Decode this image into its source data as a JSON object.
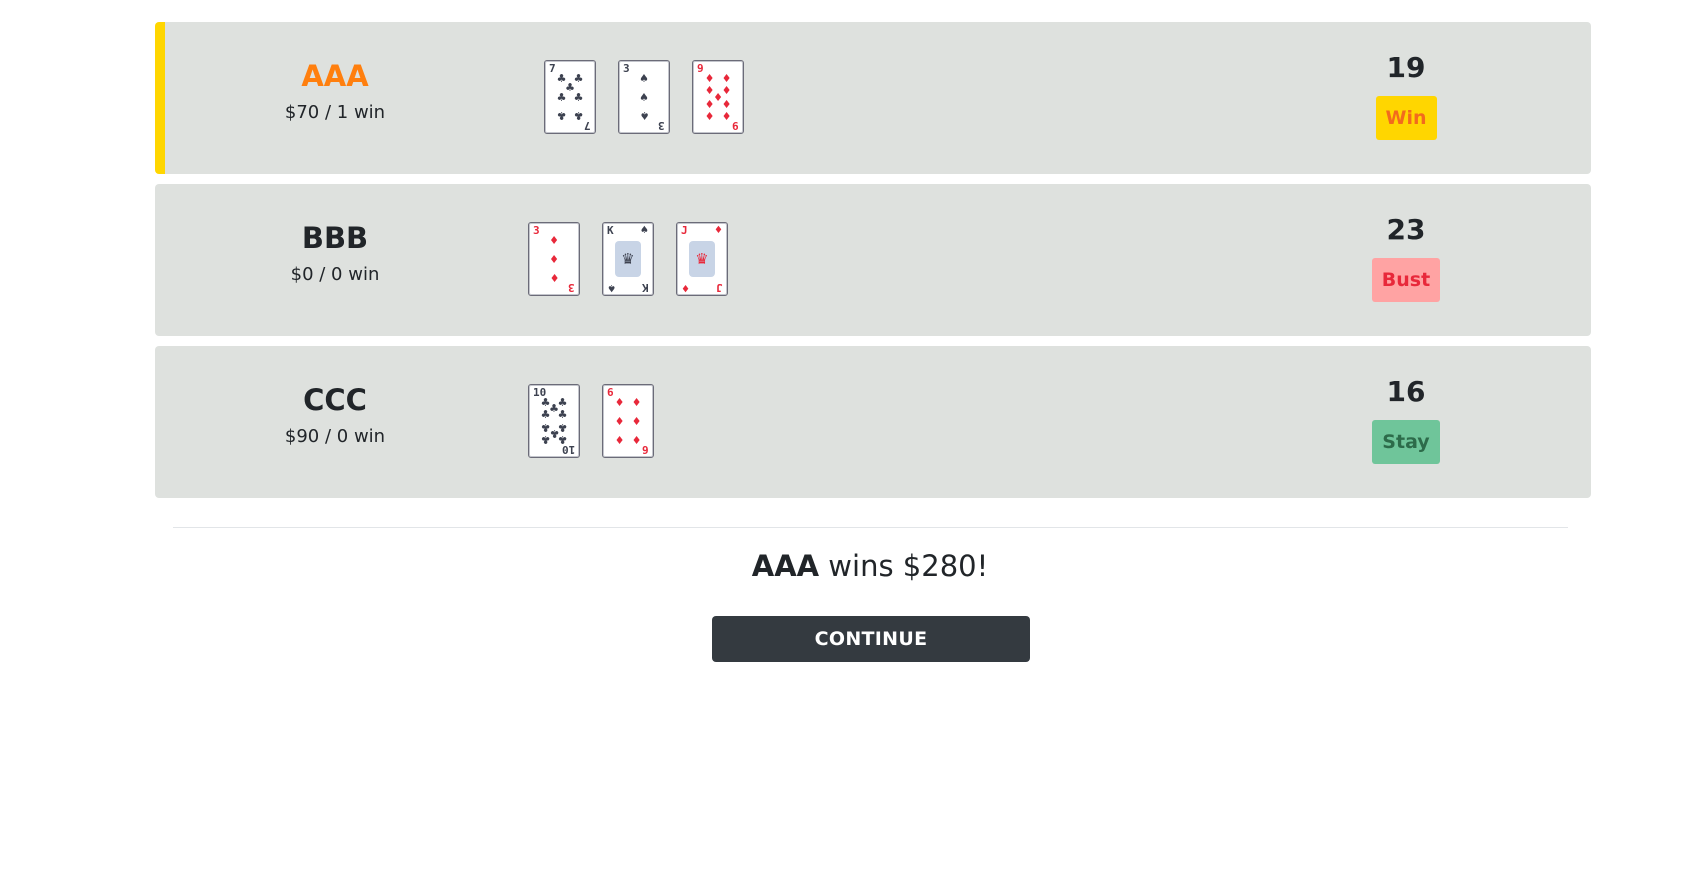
{
  "players": [
    {
      "name": "AAA",
      "stats": "$70 / 1 win",
      "score": "19",
      "status": "Win",
      "winner": true,
      "status_bg": "#ffd600",
      "status_color": "#f26b1d",
      "cards": [
        {
          "rank": "7",
          "suit": "clubs",
          "color": "black",
          "glyph": "♣",
          "type": "pips",
          "pips": 7
        },
        {
          "rank": "3",
          "suit": "spades",
          "color": "black",
          "glyph": "♠",
          "type": "pips",
          "pips": 3
        },
        {
          "rank": "9",
          "suit": "diamonds",
          "color": "red",
          "glyph": "♦",
          "type": "pips",
          "pips": 9
        }
      ]
    },
    {
      "name": "BBB",
      "stats": "$0 / 0 win",
      "score": "23",
      "status": "Bust",
      "winner": false,
      "status_bg": "#ffa3a3",
      "status_color": "#e8283a",
      "cards": [
        {
          "rank": "3",
          "suit": "diamonds",
          "color": "red",
          "glyph": "♦",
          "type": "pips",
          "pips": 3
        },
        {
          "rank": "K",
          "suit": "spades",
          "color": "black",
          "glyph": "♠",
          "type": "face"
        },
        {
          "rank": "J",
          "suit": "diamonds",
          "color": "red",
          "glyph": "♦",
          "type": "face"
        }
      ]
    },
    {
      "name": "CCC",
      "stats": "$90 / 0 win",
      "score": "16",
      "status": "Stay",
      "winner": false,
      "status_bg": "#6fc59a",
      "status_color": "#2d6b4a",
      "cards": [
        {
          "rank": "10",
          "suit": "clubs",
          "color": "black",
          "glyph": "♣",
          "type": "pips",
          "pips": 10
        },
        {
          "rank": "6",
          "suit": "diamonds",
          "color": "red",
          "glyph": "♦",
          "type": "pips",
          "pips": 6
        }
      ]
    }
  ],
  "result": {
    "winner_name": "AAA",
    "text": " wins $280!"
  },
  "continue_label": "CONTINUE",
  "colors": {
    "row_bg": "#dee1de",
    "winner_accent": "#ffd600",
    "winner_name": "#ff7f0e",
    "button_bg": "#343a40"
  }
}
